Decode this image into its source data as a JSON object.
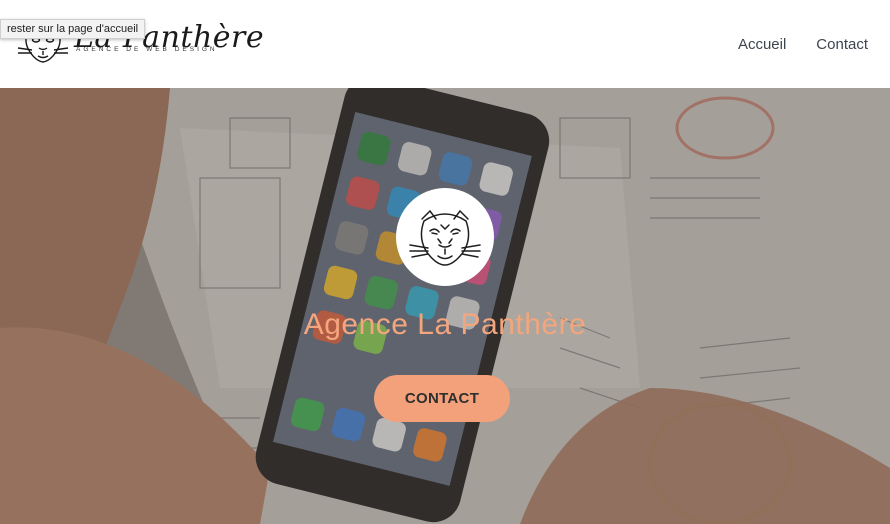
{
  "header": {
    "logo_word": "La Panthère",
    "logo_tagline": "AGENCE DE WEB DESIGN",
    "tooltip": "rester sur la page d'accueil"
  },
  "nav": {
    "items": [
      {
        "label": "Accueil"
      },
      {
        "label": "Contact"
      }
    ]
  },
  "hero": {
    "title": "Agence La Panthère",
    "cta_label": "CONTACT"
  },
  "colors": {
    "accent": "#f2a17b",
    "title": "#f3a67e",
    "nav_text": "#3d4550"
  },
  "icons": [
    "panther-logo-icon",
    "panther-head-icon"
  ]
}
